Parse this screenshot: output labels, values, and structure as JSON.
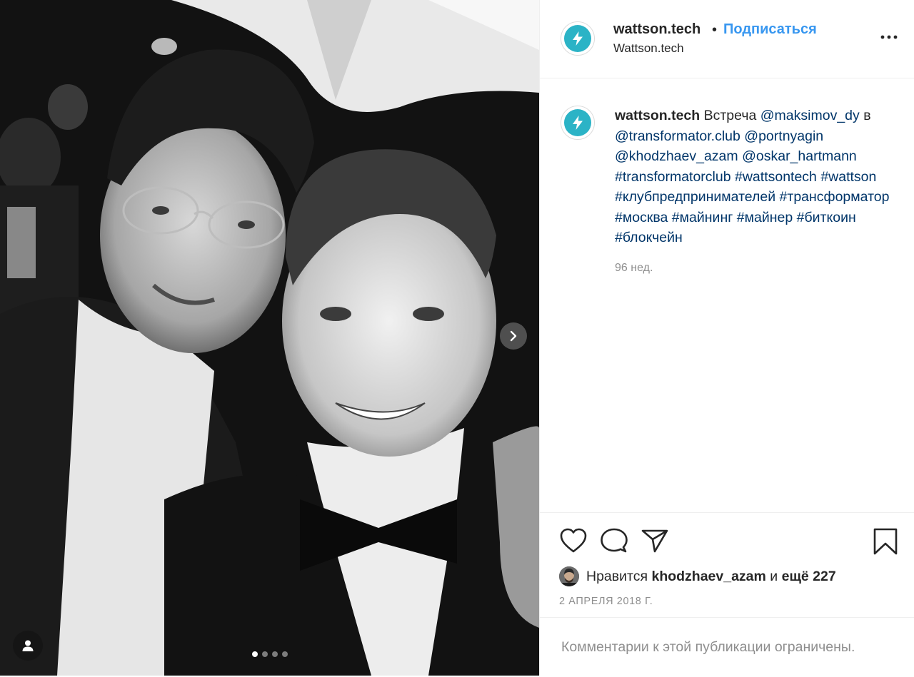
{
  "post": {
    "account": {
      "username": "wattson.tech",
      "display_name": "Wattson.tech",
      "follow_label": "Подписаться",
      "separator": "•",
      "avatar_icon": "lightning-icon",
      "avatar_color": "#2bb3c6"
    },
    "caption": {
      "username": "wattson.tech",
      "text_intro": "Встреча",
      "mention_1": "@maksimov_dy",
      "text_in": "в",
      "mention_2": "@transformator.club",
      "mention_3": "@portnyagin",
      "mention_4": "@khodzhaev_azam",
      "mention_5": "@oskar_hartmann",
      "hashtags": [
        "#transformatorclub",
        "#wattsontech",
        "#wattson",
        "#клубпредпринимателей",
        "#трансформатор",
        "#москва",
        "#майнинг",
        "#майнер",
        "#биткоин",
        "#блокчейн"
      ],
      "age": "96 нед."
    },
    "likes": {
      "prefix": "Нравится",
      "user": "khodzhaev_azam",
      "and": "и",
      "others": "ещё 227"
    },
    "date": "2 АПРЕЛЯ 2018 Г.",
    "comments_restricted": "Комментарии к этой публикации ограничены.",
    "carousel": {
      "total": 4,
      "current": 1
    },
    "colors": {
      "link": "#003569",
      "follow": "#3897f0",
      "muted": "#8e8e8e"
    }
  }
}
